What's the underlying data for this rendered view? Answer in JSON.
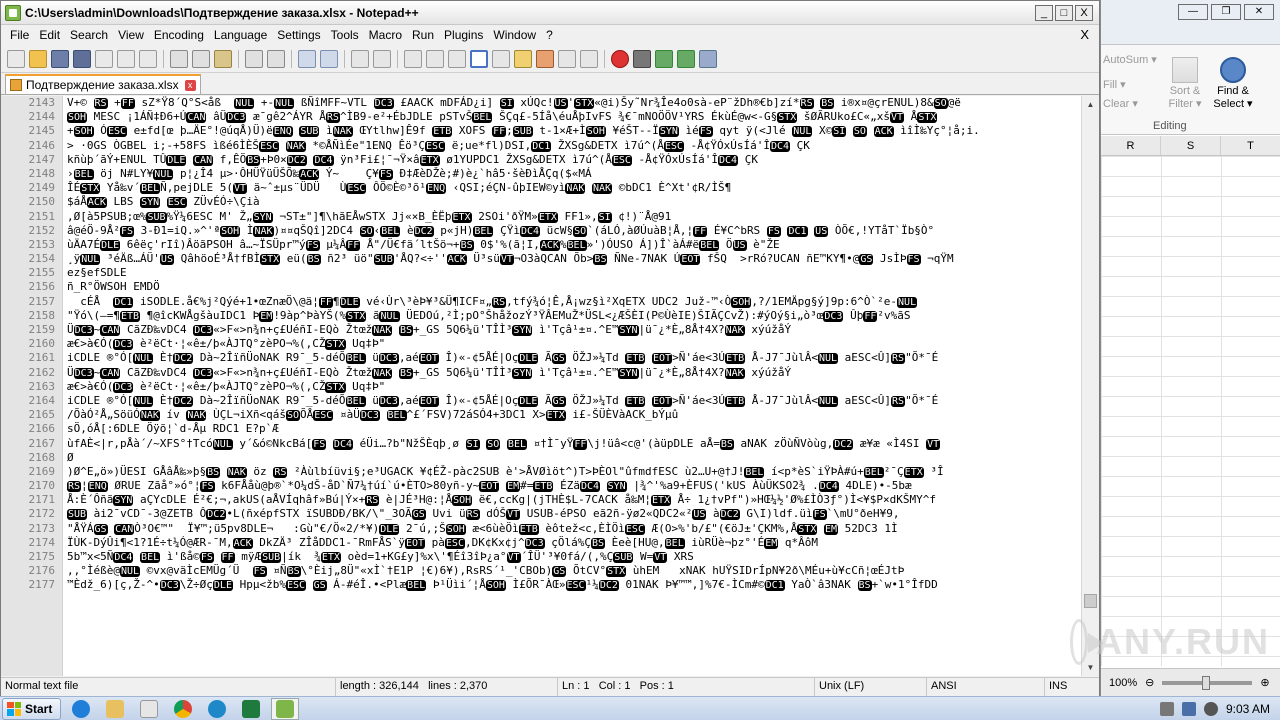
{
  "window": {
    "title": "C:\\Users\\admin\\Downloads\\Подтверждение заказа.xlsx - Notepad++",
    "controls": {
      "minimize": "_",
      "maximize": "□",
      "close": "X"
    }
  },
  "menu": {
    "items": [
      "File",
      "Edit",
      "Search",
      "View",
      "Encoding",
      "Language",
      "Settings",
      "Tools",
      "Macro",
      "Run",
      "Plugins",
      "Window",
      "?"
    ],
    "doc_close": "X"
  },
  "tab": {
    "label": "Подтверждение заказа.xlsx",
    "close": "x"
  },
  "editor": {
    "lines": [
      {
        "n": "2143",
        "t": "V+© RS +FF sZ*Ÿ8´Q°S<åß  NUL +-NUL ßÑîMFF~VTL DC3 £AACK mDFÁD¿i] SI xÚQc!US'STX«@i)Šy˜Nr¾Îe4o0sà-eP¨žDh®€b]zí*RS BS i®x¤@çrENUL)8&SO@ë"
      },
      {
        "n": "2144",
        "t": "SOH MESC ¡1ÁÑ‡Ð6+ÚCAN âÜDC3 æ¯gê2^ÁYR ÅRS^ÌB9-e²+ÉbJDLE pSTvŠBEL ŠÇq£-5Íå\\éuÅþIvFS ¾€¯mNOÖÖV¹YRS ÉkùÉ@w<-G§STX šØÃRUko£C«„xšVT ÅSTX"
      },
      {
        "n": "2145",
        "t": "+SOH ÓESC e±fd[œ þ…ÄE°!@úqÅ)Ü)ëENQ SUB ìNAK ŒYtlhw]Ê9f ETB XOFS FF;SUB t-1×Æ+ÌSOH ¥éŠT--ÏSYN ìéFS qyt ÿ(<Jlé NUL X©SI SO ACK ìîÌ‰Yç°¦å;i."
      },
      {
        "n": "2146",
        "t": "> ·0GS ÒGBEL i;-+58FS ìßé6ÌÈŠESC NAK *©ÅÑìÉe\"1ENQ Êö³ÇESC ë;ue*fl)DSI,DC1 ŽXSg&DETX ì7ú^(ÅESC -Å¢ŸÓxÚsÍá'ÎDC4 ÇK"
      },
      {
        "n": "2147",
        "t": "kñùþ´ãÝ+ENUL TÛDLE CAN f,ÊÖBS+Þ0×DC2 DC4 ÿn³Fi£¦¯¬Ÿ×âETX ø1YUPDC1 ŽXSg&DETX ì7ú^(ÅESC -Å¢ŸÓxÚsÍá'ÎDC4 ÇK"
      },
      {
        "n": "2148",
        "t": "›BEL öj N#LY¥NUL p¦¿Î4 µ>·ÔHÜŸüÜŠÕ‰ACK Ý~    Ç¥FS Ð‡ÆèDŽè;#)è¿`hâ5·šèÐìÅÇq($«MÁ"
      },
      {
        "n": "2149",
        "t": "ÎÉSTX Yå‰v´BELÑ,pejDLE 5(VT ä~ˆ±µs¨ÜDÜ   ÙESC ÔÖ©È©³õ¹ENQ ‹QSI;éÇN-ûþIEW©yìNAK NAK ©bDC1 È^Xt'¢R/ÌŠ¶"
      },
      {
        "n": "2150",
        "t": "$áÅACK LBS SYN ESC ZÜvÉÓ÷\\Çià"
      },
      {
        "n": "2151",
        "t": ",Ø[à5PSUB;œ%SUB%Ÿ¼6ESC M' Ž„SYN ¬ST±\"]¶\\hãEÅwSTX Jj«×B_ÈËþETX 2SOi'ðŸM»ETX FF1»,SI ¢!)¨Å@91"
      },
      {
        "n": "2152",
        "t": "â@éÖ-9Å²FS 3-Ð1=iQ.»^'ªSOH ÌNAK)¤¤qŠQî]2DC4 SO‹BEL èDC2 p«jH)BEL ÇŸìDC4 ücW§SO`(áLÓ,àØÚuàB¦Å,¦FF É¥C^bRS FS DC1 US ÒÕ€,!YTåT`Ïb§Ò°"
      },
      {
        "n": "2153",
        "t": "ùÄA7ÉDLE 6êëç'rIî)ÂöãPSOH â…~ÏSÜpr™ýFS µ¼ÂFF Å\"/Ü€fä´ltŠö¬+BS 0$'%(ã¦I,ACK%BEL»')ÓUSO Á])Î`àÁ#ëBEL ÖUS è\"ŽE"
      },
      {
        "n": "2154",
        "t": "¸ÿNUL ³éÄß…ÁÜ'US QâhöoÉ³Å†fBÌSTX eü(BS ñ2³ üö\"SUB'ÅQ?<÷''ACK Ü³süVT¬O3àQCAN Õb>BS ÑNe-7NAK ÚEOT fŠQ  >rRó?UCAN ñE™KY¶•@GS JsÌÞFS ¬qŸM"
      },
      {
        "n": "2155",
        "t": "ez§efSDLE"
      },
      {
        "n": "2156",
        "t": "ñ_R°ÖWSOH EMDÖ"
      },
      {
        "n": "2157",
        "t": "  cÉÅ  DC1 iSODLE.å€%j²Qýé+1•œZnæÖ\\@ä¦FF¶DLE vé‹Ùr\\³èÞ¥³&Ü¶ICF¤„RS,tfý¾ó¦Ê,Å¡wz§ì²XqETX UDC2 Juž-™‹ÒSOH,?/1EMÄpg§ý]9p:6^Ò`²e-NUL"
      },
      {
        "n": "2158",
        "t": "\"Ÿó\\(—=¶ETB ¶@îcKWÅgšàuIDC1 ÞEM!9àp^ÞàYŠ(%STX ãNUL ÜEDOú,²Ì;pO°ŠhåžozÝ³ŸÂEMuŽ*ÜSL<¿ÆŠÈI(P©ÙèIE)ŠIÃÇCvŽ):#ýOý§i„ò³œDC3 ÛþFF²v%ãS"
      },
      {
        "n": "2159",
        "t": "ÜDC3~CAN CãZÐ‰vDC4 DC3«>F«>n¾n+ç£UéñI-EQò ŽtœžNAK BS+_GS 5Q6¼ü'TÎÌ³SYN ì'Tçâ¹±¤.^E™SYN|ü¯¿*È„8Å†4X?NAK xýúžåÝ"
      },
      {
        "n": "2160",
        "t": "æ€>à€Ó(DC3 è²ëCt·¦«ê±/þ«ÀJTQ°zèPO¬%(,CŽSTX Uq‡Þ\""
      },
      {
        "n": "2161",
        "t": "iCDLE ®°Ó[NUL È†DC2 Dà~2ÎïñÜoNAK R9¯_5-déÕBEL üDC3,aéEOT Î)«-¢5ÅÉ|OçDLE ÃGS ÖŽJ»¼Td ETB EOT>Ñ'áe<3ÚETB Å-J7¯JùlÂ<NUL aESC<Û]RS\"Õ*¯É"
      },
      {
        "n": "2162",
        "t": "ÜDC3~CAN CãZÐ‰vDC4 DC3«>F«>n¾n+ç£UéñI-EQò ŽtœžNAK BS+_GS 5Q6¼ü'TÎÌ³SYN ì'Tçâ¹±¤.^E™SYN|ü¯¿*È„8Å†4X?NAK xýúžåÝ"
      },
      {
        "n": "2163",
        "t": "æ€>à€Ó(DC3 è²ëCt·¦«ê±/þ«ÀJTQ°zèPO¬%(,CŽSTX Uq‡Þ\""
      },
      {
        "n": "2164",
        "t": "iCDLE ®°Ó[NUL È†DC2 Dà~2ÎïñÜoNAK R9¯_5-déÕBEL üDC3,aéEOT Î)«-¢5ÅÉ|OçDLE ÃGS ÖŽJ»¼Td ETB EOT>Ñ'áe<3ÚETB Å-J7¯JùlÂ<NUL aESC<Û]RS\"Õ*¯É"
      },
      {
        "n": "2165",
        "t": "/ÕàÓ²Å„SöüÓNAK ív NAK ÙÇL¬iXñ<qášSOÕÅESC ¤àÜDC3 BEL^£´FSV)72áSÓ4+3DC1 X>ETX i£-ŠÜÈVàACK_bÝµû"
      },
      {
        "n": "2166",
        "t": "sÖ,óÅ[:6DLE Öÿõ¦`d-Åµ RDC1 E?p`Æ"
      },
      {
        "n": "2167",
        "t": "ùfAÈ<|r,pÅà´/~XFS°†TcóNUL y´&ó©NkcBá[FS DC4 éÜi…?b\"NžŠÈqþ¸ø SI SO BEL ¤†Ì¯yŸFF\\j!üâ<c@'(àüpDLE aÅ=BS aNAK zÖùÑVòùg,DC2 æ¥æ «Ì4SI VT"
      },
      {
        "n": "2168",
        "t": "Ø"
      },
      {
        "n": "2169",
        "t": ")Ø^E„ö»)ÜESI GÅâÅ‰»þ§BS NAK öz RS ²Àùlbíüvi§;e³UGACK ¥¢ÉŽ-pàc2SUB è'>ÅVØìöt^)T>ÞÈOl\"ûfmdfESC ù2…U+@†J!BEL í<p*èS`iŸÞÀ#ú+BEL²¯ÇETX ³Î"
      },
      {
        "n": "2170",
        "t": "RS¦ENQ ØRUE Zãå°»ó°¦FS k6FÅåù@þ®`*O¼dŠ-åD`Ñ7¼†úí`ú•ÈTO>80yñ-y~EOT EM#=ETB ÉZäDC4 SYN |¾^'%a9+ÈFUS('kUS ÀùÜKSO2¾ .DC4 4DLE)•-5bæ"
      },
      {
        "n": "2171",
        "t": "Å:È´ÔñãSYN aÇYcDLE É²€;¬,akUS(aÅVÍqhâf»Bú|Ý×+RS è|JÉ³H@:¦ÅSOH ë€,ccKg|(jTHÈ$L-7CACK å‰M¦ETX Å÷ 1¿†vPf\")»HŒ¼½'Ø%£ÌÒ3ƒ°)Ì<¥$P×dKŠMY^f"
      },
      {
        "n": "2172",
        "t": "SUB ài2¯vCD¯-3@ZETB ÔDC2•L(ñxépfSTX ïSUBDÐ/BK/\\\"_3OÃGS Uvi üRS dÓŠVT USUB-éPSO eã2ñ-ÿø2«QDC2«²US àDC2 G\\I)ldf.üìFS`\\mU°ðeH¥9,"
      },
      {
        "n": "2173",
        "t": "\"ÅŸÁGS CANÒ³O€™\"  Ï¥™;ü5pv8DLE¬   :Gù\"€/Ö«2/*¥)DLE 2¯ú,;ŠSOH æ<6ùèÖìETB èôtež<c,ÈÌÖìESC Æ(O>%'b/£\"(€öJ±'ÇKM%,ÅSTX EM 52DC3 1Ì"
      },
      {
        "n": "2174",
        "t": "ÏÙK-DýÛi¶<1?1É÷t¼Ó@ÆR-¯M,ACK DkZÄ³ ZÎåDDC1-¯RmFÅS`ÿEOT pàESC,DK¢Kx¢j^DC3 çÖlá%ÇBS Èeè[HU@,BEL iùRÜè¬þz°'ÉEM q*ÂôM"
      },
      {
        "n": "2175",
        "t": "5b™x<5ÑDC4 BEL ì'ßå©FS FF mÿÆSUB|ík  ¾ETX oèd=1+KG£y]%x\\'¶Éî3îÞ¿a°VT´ÎÜ'³¥0fá/(,%ÇSUB W=VT XRS"
      },
      {
        "n": "2176",
        "t": ",,°Ìéßè@NUL ©vx@väÌcEMÜg´Ü  FS ¤ÑBS\\°Èij„8Ü\"«xÌ`†E1P ¦€)6¥),RsRS´¹_'CBOb)GS ÕtCV°STX ùhEM   xNAK hUŸSIDrÍpN¥2ð\\MÉu+ù¥cCñ¦œÉJtÞ"
      },
      {
        "n": "2177",
        "t": "™Èdž_6)[ç,Ž-^•DC3\\Ž÷ØçDLE Hpµ<žb%ESC GS Á-#éÎ.•<PlæBEL Þ¹Üìi´¦ÅSOH Ì£ÕR¯ÀŒ»ESC¹¼DC2 01NAK Þ¥™™,]%7€-ÌCm#©DC1 YaÒ`â3NAK BS+`w•1°ÎfDD"
      }
    ]
  },
  "status": {
    "type": "Normal text file",
    "length": "length : 326,144",
    "lines": "lines : 2,370",
    "ln": "Ln : 1",
    "col": "Col : 1",
    "pos": "Pos : 1",
    "eol": "Unix (LF)",
    "encoding": "ANSI",
    "mode": "INS"
  },
  "excel": {
    "ribbon": {
      "autosum": "AutoSum ▾",
      "fill": "Fill ▾",
      "clear": "Clear ▾",
      "sort_filter": "Sort & Filter ▾",
      "find_select": "Find & Select ▾",
      "group": "Editing"
    },
    "columns": [
      "R",
      "S",
      "T"
    ],
    "zoom": "100%"
  },
  "watermark": "ANY.RUN",
  "taskbar": {
    "start": "Start",
    "time": "9:03 AM"
  }
}
